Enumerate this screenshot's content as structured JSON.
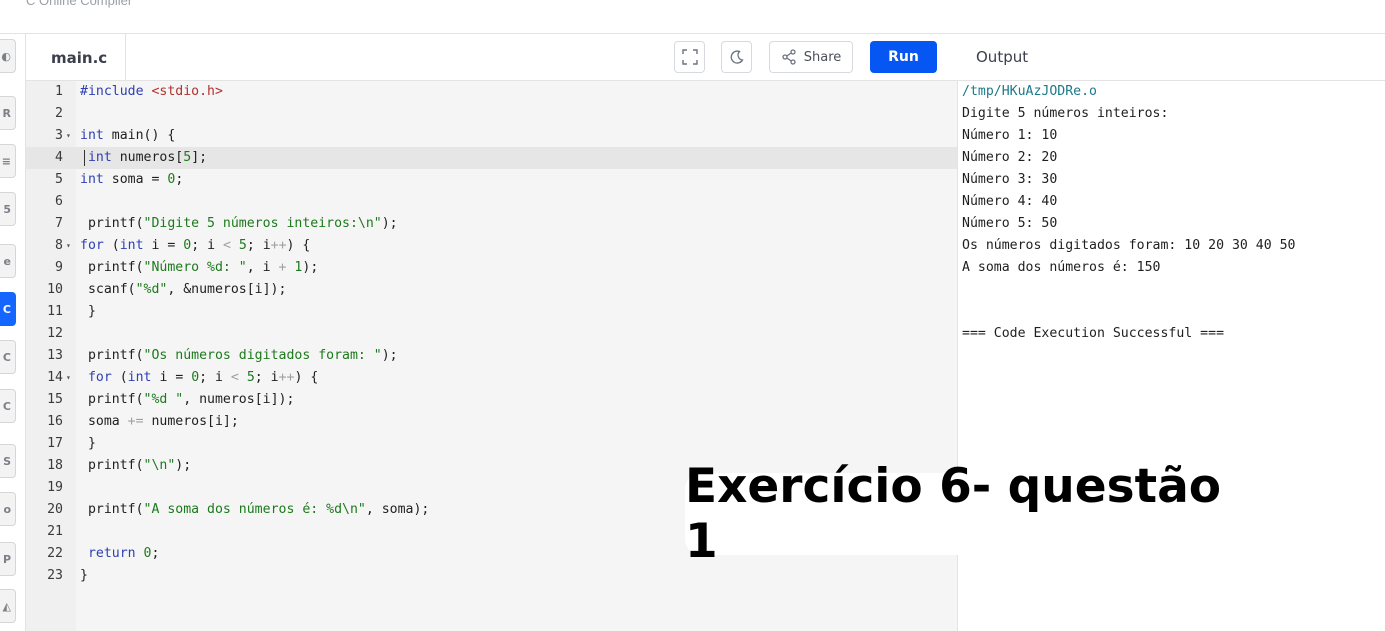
{
  "app": {
    "title": "C Online Compiler"
  },
  "sidebar": {
    "icons": [
      {
        "name": "python-icon",
        "glyph": "◐"
      },
      {
        "name": "r-icon",
        "glyph": "R"
      },
      {
        "name": "database-icon",
        "glyph": "≡"
      },
      {
        "name": "html-icon",
        "glyph": "5"
      },
      {
        "name": "java-icon",
        "glyph": "e"
      },
      {
        "name": "c-icon",
        "glyph": "C",
        "active": true
      },
      {
        "name": "cpp-icon",
        "glyph": "C"
      },
      {
        "name": "csharp-icon",
        "glyph": "C"
      },
      {
        "name": "js-icon",
        "glyph": "S"
      },
      {
        "name": "go-icon",
        "glyph": "o"
      },
      {
        "name": "php-icon",
        "glyph": "P"
      },
      {
        "name": "swift-icon",
        "glyph": "◭"
      }
    ]
  },
  "editor": {
    "file_name": "main.c",
    "toolbar": {
      "fullscreen_icon": "expand-icon",
      "theme_icon": "moon-icon",
      "share_label": "Share",
      "share_icon": "share-icon",
      "run_label": "Run"
    },
    "lines": [
      {
        "n": "1",
        "code": "#include <stdio.h>"
      },
      {
        "n": "2",
        "code": ""
      },
      {
        "n": "3",
        "code": "int main() {",
        "fold": true
      },
      {
        "n": "4",
        "code": " int numeros[5];"
      },
      {
        "n": "5",
        "code": "int soma = 0;"
      },
      {
        "n": "6",
        "code": ""
      },
      {
        "n": "7",
        "code": " printf(\"Digite 5 números inteiros:\\n\");"
      },
      {
        "n": "8",
        "code": "for (int i = 0; i < 5; i++) {",
        "fold": true
      },
      {
        "n": "9",
        "code": " printf(\"Número %d: \", i + 1);"
      },
      {
        "n": "10",
        "code": " scanf(\"%d\", &numeros[i]);"
      },
      {
        "n": "11",
        "code": " }"
      },
      {
        "n": "12",
        "code": ""
      },
      {
        "n": "13",
        "code": " printf(\"Os números digitados foram: \");"
      },
      {
        "n": "14",
        "code": " for (int i = 0; i < 5; i++) {",
        "fold": true
      },
      {
        "n": "15",
        "code": " printf(\"%d \", numeros[i]);"
      },
      {
        "n": "16",
        "code": " soma += numeros[i];"
      },
      {
        "n": "17",
        "code": " }"
      },
      {
        "n": "18",
        "code": " printf(\"\\n\");"
      },
      {
        "n": "19",
        "code": ""
      },
      {
        "n": "20",
        "code": " printf(\"A soma dos números é: %d\\n\", soma);"
      },
      {
        "n": "21",
        "code": ""
      },
      {
        "n": "22",
        "code": " return 0;"
      },
      {
        "n": "23",
        "code": "}"
      }
    ]
  },
  "output": {
    "header": "Output",
    "lines": [
      "/tmp/HKuAzJODRe.o",
      "Digite 5 números inteiros:",
      "Número 1: 10",
      "Número 2: 20",
      "Número 3: 30",
      "Número 4: 40",
      "Número 5: 50",
      "Os números digitados foram: 10 20 30 40 50",
      "A soma dos números é: 150",
      "",
      "",
      "=== Code Execution Successful ==="
    ]
  },
  "overlay": {
    "caption": "Exercício 6- questão 1"
  }
}
